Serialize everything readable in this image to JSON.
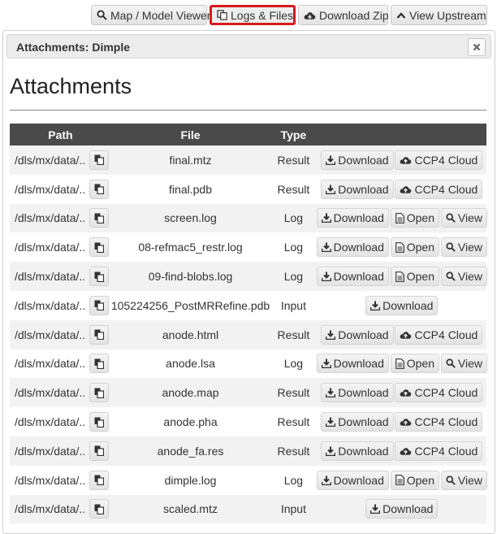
{
  "toolbar": {
    "map_viewer_label": "Map / Model Viewer",
    "logs_files_label": "Logs & Files",
    "download_zip_label": "Download Zip",
    "view_upstream_label": "View Upstream"
  },
  "panel": {
    "title": "Attachments: Dimple",
    "close_icon": "close-icon"
  },
  "heading": "Attachments",
  "table": {
    "columns": [
      "Path",
      "File",
      "Type",
      ""
    ],
    "download_label": "Download",
    "cloud_label": "CCP4 Cloud",
    "open_label": "Open",
    "view_label": "View",
    "rows": [
      {
        "path": "/dls/mx/data/...",
        "file": "final.mtz",
        "type": "Result",
        "actions": "download-cloud"
      },
      {
        "path": "/dls/mx/data/...",
        "file": "final.pdb",
        "type": "Result",
        "actions": "download-cloud"
      },
      {
        "path": "/dls/mx/data/...",
        "file": "screen.log",
        "type": "Log",
        "actions": "download-open-view"
      },
      {
        "path": "/dls/mx/data/...",
        "file": "08-refmac5_restr.log",
        "type": "Log",
        "actions": "download-open-view"
      },
      {
        "path": "/dls/mx/data/...",
        "file": "09-find-blobs.log",
        "type": "Log",
        "actions": "download-open-view"
      },
      {
        "path": "/dls/mx/data/...",
        "file": "105224256_PostMRRefine.pdb",
        "type": "Input",
        "actions": "download"
      },
      {
        "path": "/dls/mx/data/...",
        "file": "anode.html",
        "type": "Result",
        "actions": "download-cloud"
      },
      {
        "path": "/dls/mx/data/...",
        "file": "anode.lsa",
        "type": "Log",
        "actions": "download-open-view"
      },
      {
        "path": "/dls/mx/data/...",
        "file": "anode.map",
        "type": "Result",
        "actions": "download-cloud"
      },
      {
        "path": "/dls/mx/data/...",
        "file": "anode.pha",
        "type": "Result",
        "actions": "download-cloud"
      },
      {
        "path": "/dls/mx/data/...",
        "file": "anode_fa.res",
        "type": "Result",
        "actions": "download-cloud"
      },
      {
        "path": "/dls/mx/data/...",
        "file": "dimple.log",
        "type": "Log",
        "actions": "download-open-view"
      },
      {
        "path": "/dls/mx/data/...",
        "file": "scaled.mtz",
        "type": "Input",
        "actions": "download"
      }
    ]
  },
  "colors": {
    "highlight": "#d7191c",
    "table_header": "#4a4a4a",
    "stripe": "#f2f2f2"
  }
}
